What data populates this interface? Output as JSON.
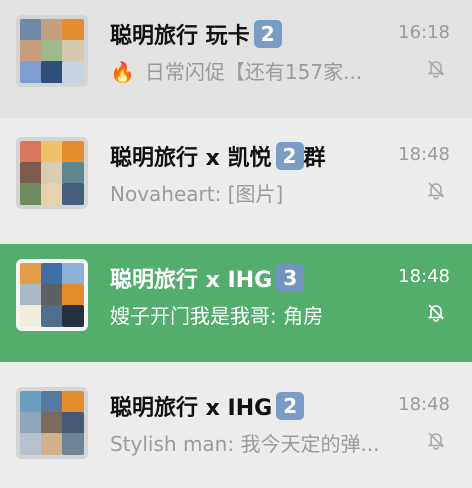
{
  "chats": [
    {
      "title": "聪明旅行 玩卡",
      "badge": "2",
      "title_tail": "",
      "time": "16:18",
      "preview_icon": "🔥",
      "preview": "日常闪促【还有157家...",
      "muted_icon": "bell-off-icon",
      "selected": false
    },
    {
      "title": "聪明旅行 x 凯悦",
      "badge": "2",
      "title_tail": "群",
      "time": "18:48",
      "preview": "Novaheart: [图片]",
      "muted_icon": "bell-off-icon",
      "selected": false
    },
    {
      "title": "聪明旅行 x IHG",
      "badge": "3",
      "title_tail": "",
      "time": "18:48",
      "preview": "嫂子开门我是我哥: 角房",
      "muted_icon": "bell-off-icon",
      "selected": true
    },
    {
      "title": "聪明旅行 x IHG",
      "badge": "2",
      "title_tail": "",
      "time": "18:48",
      "preview": "Stylish man: 我今天定的弹...",
      "muted_icon": "bell-off-icon",
      "selected": false
    }
  ],
  "colors": {
    "selected_row": "#53ad6c",
    "badge": "#7a9dc7",
    "muted_text": "#9b9b9b",
    "title_text": "#111111",
    "fire": "#f07026"
  }
}
